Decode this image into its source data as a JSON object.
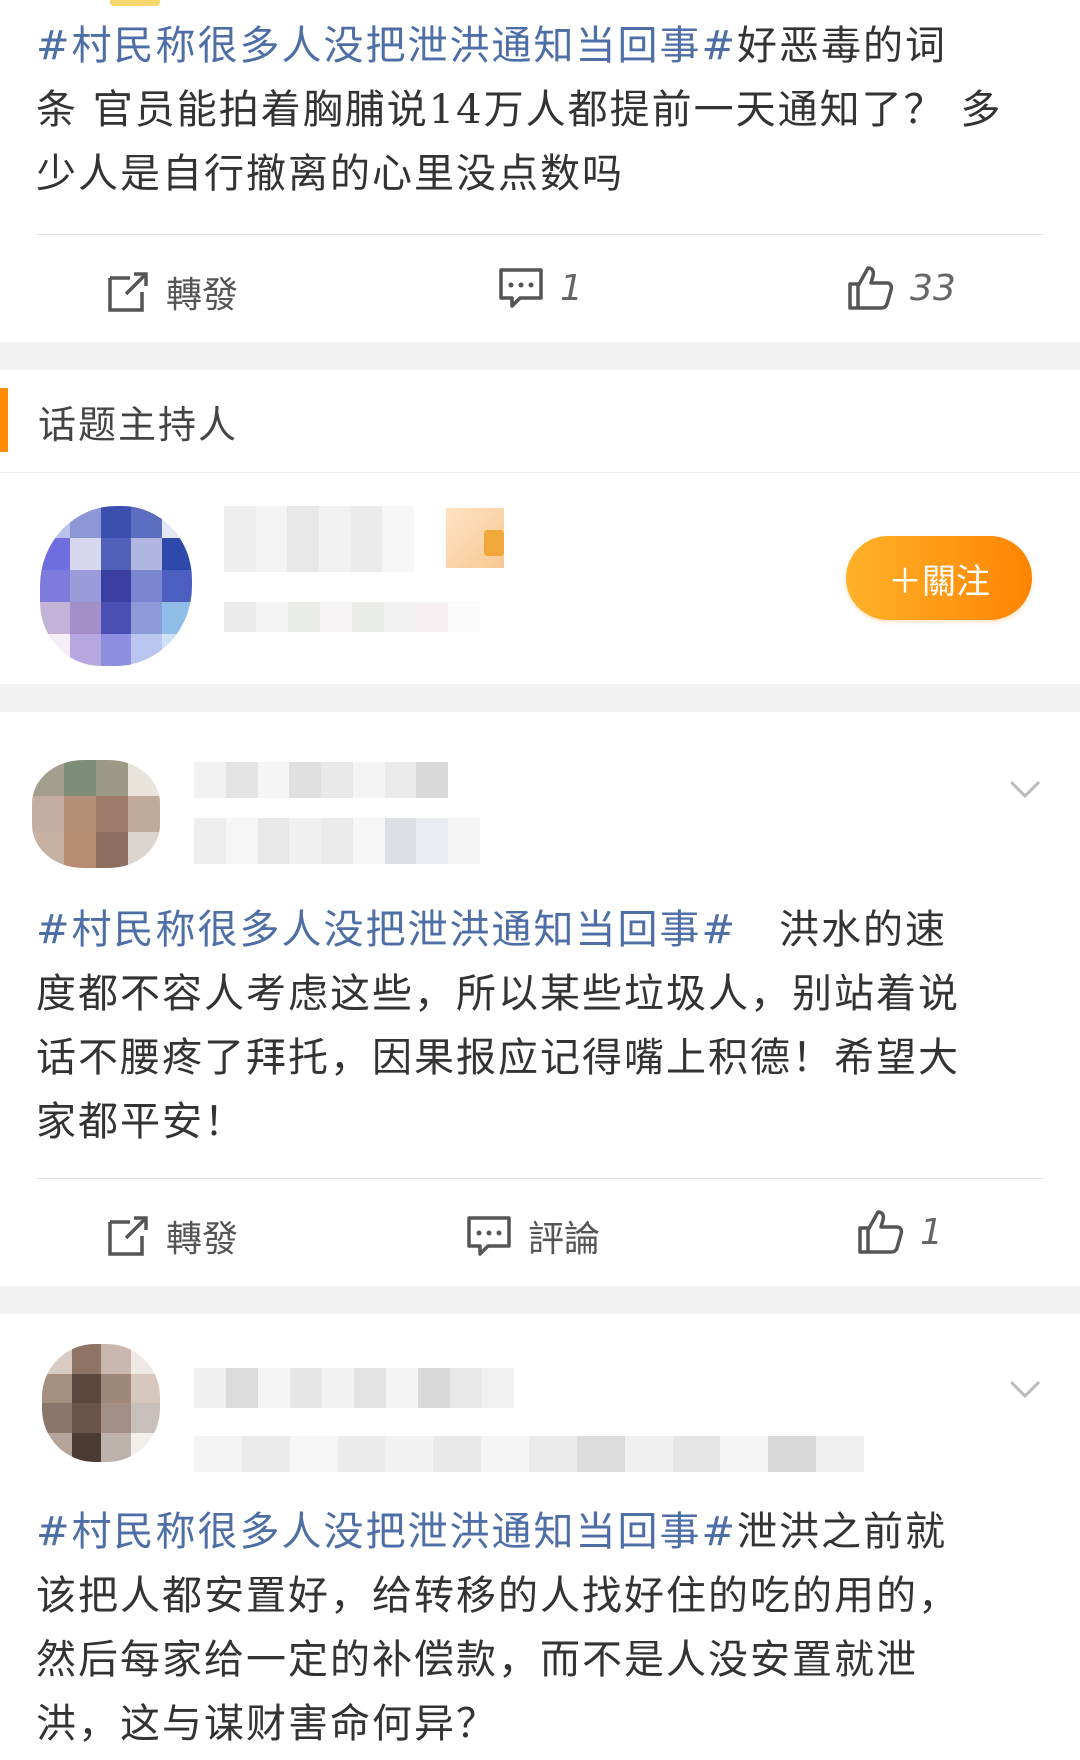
{
  "posts": [
    {
      "tag": "#村民称很多人没把泄洪通知当回事#",
      "text_lines": [
        "好恶毒的词",
        "条 官员能拍着胸脯说14万人都提前一天通知了？ 多",
        "少人是自行撤离的心里没点数吗"
      ],
      "actions": {
        "repost": "轉發",
        "comment_count": "1",
        "like_count": "33"
      }
    },
    {
      "tag": "#村民称很多人没把泄洪通知当回事#",
      "text_lines": [
        "　洪水的速",
        "度都不容人考虑这些，所以某些垃圾人，别站着说",
        "话不腰疼了拜托，因果报应记得嘴上积德！希望大",
        "家都平安！"
      ],
      "actions": {
        "repost": "轉發",
        "comment": "評論",
        "like_count": "1"
      }
    },
    {
      "tag": "#村民称很多人没把泄洪通知当回事#",
      "text_lines": [
        "泄洪之前就",
        "该把人都安置好，给转移的人找好住的吃的用的，",
        "然后每家给一定的补偿款，而不是人没安置就泄",
        "洪，这与谋财害命何异？"
      ]
    }
  ],
  "host_section": {
    "title": "话题主持人",
    "follow_label": "＋關注"
  },
  "colors": {
    "accent_orange": "#ff8c00",
    "topic_blue": "#4e6ea6",
    "bg_gap": "#f2f2f2"
  },
  "icons": [
    "repost-icon",
    "comment-icon",
    "like-icon",
    "chevron-down-icon"
  ]
}
